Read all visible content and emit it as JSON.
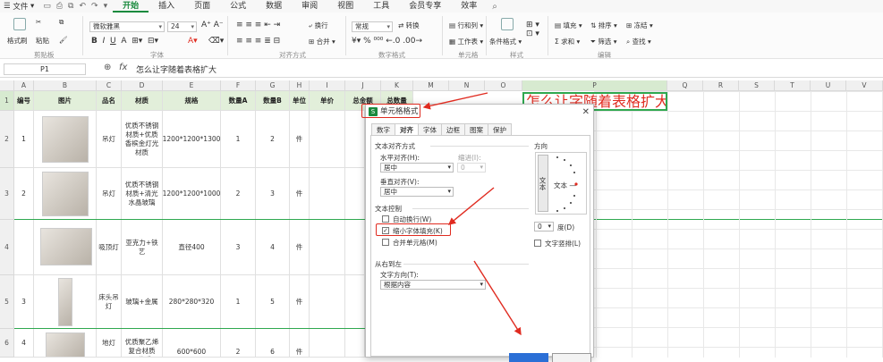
{
  "menubar": {
    "file": "文件",
    "tabs": [
      "开始",
      "插入",
      "页面",
      "公式",
      "数据",
      "审阅",
      "视图",
      "工具",
      "会员专享",
      "效率"
    ],
    "active_tab": "开始"
  },
  "ribbon": {
    "clipboard": {
      "paste": "格式刷",
      "brush": "格式刷",
      "paste2": "粘贴",
      "label": "剪贴板"
    },
    "font": {
      "name": "微软雅黑",
      "size": "24",
      "label": "字体"
    },
    "align": {
      "wrap": "换行",
      "merge": "合并",
      "label": "对齐方式"
    },
    "number": {
      "format": "常规",
      "convert": "转换",
      "label": "数字格式"
    },
    "cells": {
      "rowcol": "行和列",
      "sheet": "工作表",
      "label": "单元格"
    },
    "styles": {
      "cond": "条件格式",
      "label": "样式"
    },
    "edit": {
      "fill": "填充",
      "sort": "排序",
      "freeze": "冻结",
      "sum": "求和",
      "filter": "筛选",
      "find": "查找",
      "label": "编辑"
    }
  },
  "formula_bar": {
    "cell_ref": "P1",
    "fx": "fx",
    "content": "怎么让字随着表格扩大"
  },
  "columns": [
    "A",
    "B",
    "C",
    "D",
    "E",
    "F",
    "G",
    "H",
    "I",
    "J",
    "K",
    "M",
    "N",
    "O",
    "P",
    "Q",
    "R",
    "S",
    "T",
    "U",
    "V"
  ],
  "table": {
    "headers": [
      "编号",
      "图片",
      "品名",
      "材质",
      "规格",
      "数量A",
      "数量B",
      "单位",
      "单价",
      "总金额",
      "总数量"
    ],
    "rows": [
      {
        "num": "2",
        "id": "1",
        "name": "吊灯",
        "material": "优质不锈钢材质+优质香槟金灯光材质",
        "spec": "1200*1200*1300",
        "qa": "1",
        "qb": "2",
        "unit": "件"
      },
      {
        "num": "3",
        "id": "2",
        "name": "吊灯",
        "material": "优质不锈钢材质+清光水晶玻璃",
        "spec": "1200*1200*1000",
        "qa": "2",
        "qb": "3",
        "unit": "件"
      },
      {
        "num": "4",
        "id": "",
        "name": "吸顶灯",
        "material": "亚克力+铁艺",
        "spec": "直径400",
        "qa": "3",
        "qb": "4",
        "unit": "件"
      },
      {
        "num": "5",
        "id": "3",
        "name": "床头吊灯",
        "material": "玻璃+金属",
        "spec": "280*280*320",
        "qa": "1",
        "qb": "5",
        "unit": "件"
      },
      {
        "num": "6",
        "id": "4",
        "name": "地灯",
        "material": "优质聚乙烯复合材质+优质",
        "spec": "600*600",
        "qa": "2",
        "qb": "6",
        "unit": "件"
      }
    ],
    "row1_num": "1",
    "title_text": "怎么让字随着表格扩大"
  },
  "dialog": {
    "title": "单元格格式",
    "tabs": [
      "数字",
      "对齐",
      "字体",
      "边框",
      "图案",
      "保护"
    ],
    "active_tab": "对齐",
    "text_align_section": "文本对齐方式",
    "horizontal_label": "水平对齐(H):",
    "horizontal_value": "居中",
    "indent_label": "缩进(I):",
    "indent_value": "0",
    "vertical_label": "垂直对齐(V):",
    "vertical_value": "居中",
    "text_control_section": "文本控制",
    "wrap_label": "自动换行(W)",
    "shrink_label": "缩小字体填充(K)",
    "merge_label": "合并单元格(M)",
    "rtl_section": "从右到左",
    "direction_label": "文字方向(T):",
    "direction_value": "根据内容",
    "orientation_label": "方向",
    "vertical_text": "文本",
    "orient_text": "文本 —",
    "degree_value": "0",
    "degree_label": "度(D)",
    "stacked_label": "文字竖排(L)",
    "shrink_checked": true
  }
}
